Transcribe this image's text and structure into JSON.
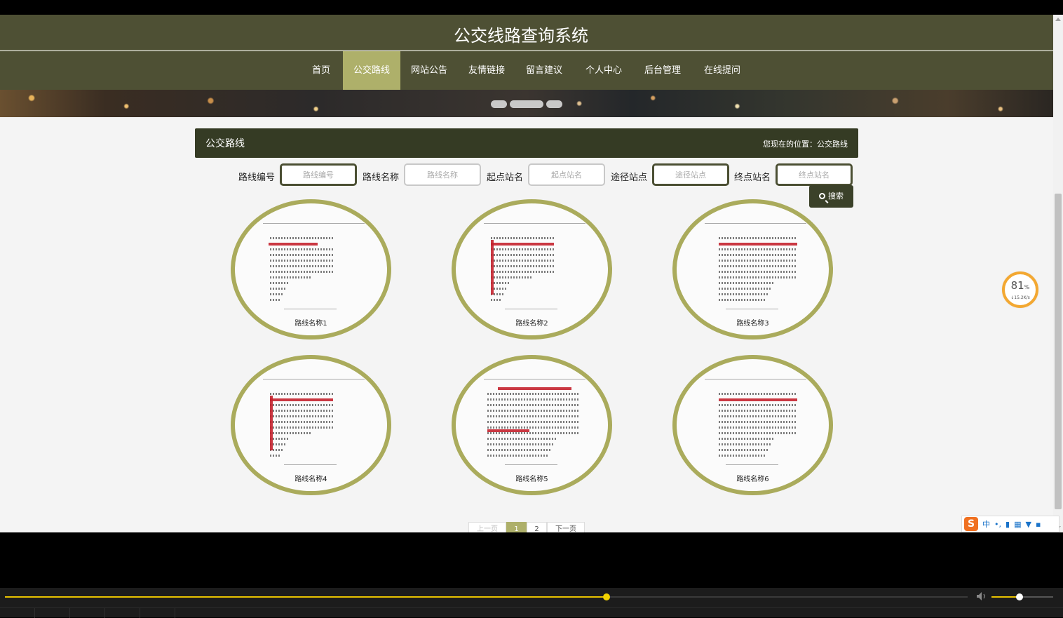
{
  "site": {
    "title": "公交线路查询系统"
  },
  "nav": {
    "items": [
      {
        "label": "首页",
        "active": false
      },
      {
        "label": "公交路线",
        "active": true
      },
      {
        "label": "网站公告",
        "active": false
      },
      {
        "label": "友情链接",
        "active": false
      },
      {
        "label": "留言建议",
        "active": false
      },
      {
        "label": "个人中心",
        "active": false
      },
      {
        "label": "后台管理",
        "active": false
      },
      {
        "label": "在线提问",
        "active": false
      }
    ]
  },
  "panel": {
    "title": "公交路线",
    "breadcrumb": "您现在的位置：公交路线"
  },
  "filters": [
    {
      "label": "路线编号",
      "placeholder": "路线编号"
    },
    {
      "label": "路线名称",
      "placeholder": "路线名称"
    },
    {
      "label": "起点站名",
      "placeholder": "起点站名"
    },
    {
      "label": "途径站点",
      "placeholder": "途径站点"
    },
    {
      "label": "终点站名",
      "placeholder": "终点站名"
    }
  ],
  "search": {
    "label": "搜索",
    "icon": "search-icon"
  },
  "routes": [
    {
      "name": "路线名称1"
    },
    {
      "name": "路线名称2"
    },
    {
      "name": "路线名称3"
    },
    {
      "name": "路线名称4"
    },
    {
      "name": "路线名称5"
    },
    {
      "name": "路线名称6"
    }
  ],
  "pagination": {
    "prev": "上一页",
    "pages": [
      "1",
      "2"
    ],
    "current": "1",
    "next": "下一页"
  },
  "speed_widget": {
    "percent": "81",
    "unit": "%",
    "rate": "↓15.2K/s"
  },
  "ime": {
    "logo": "S",
    "mode": "中"
  },
  "player": {
    "progress": 0.625,
    "volume": 0.45
  },
  "colors": {
    "header": "#4e5034",
    "accent": "#aeb06a",
    "panel": "#353b24",
    "card_ring": "#aaab5c"
  }
}
